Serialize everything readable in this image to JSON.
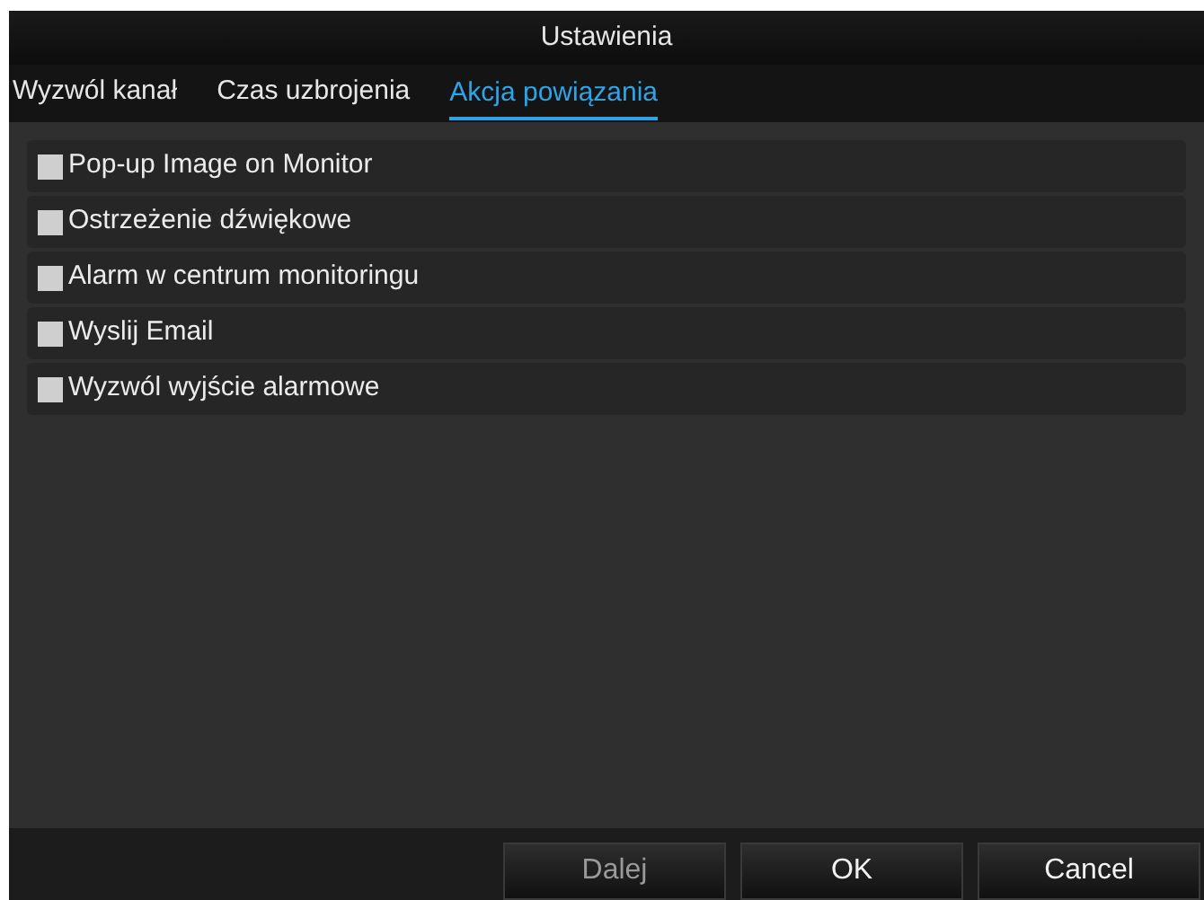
{
  "window": {
    "title": "Ustawienia"
  },
  "tabs": [
    {
      "label": "Wyzwól kanał",
      "selected": false
    },
    {
      "label": "Czas uzbrojenia",
      "selected": false
    },
    {
      "label": "Akcja powiązania",
      "selected": true
    }
  ],
  "options": [
    {
      "label": "Pop-up Image on Monitor",
      "checked": false
    },
    {
      "label": "Ostrzeżenie dźwiękowe",
      "checked": false
    },
    {
      "label": "Alarm w centrum monitoringu",
      "checked": false
    },
    {
      "label": "Wyslij Email",
      "checked": false
    },
    {
      "label": "Wyzwól wyjście alarmowe",
      "checked": false
    }
  ],
  "buttons": [
    {
      "label": "Dalej",
      "disabled": true
    },
    {
      "label": "OK",
      "disabled": false
    },
    {
      "label": "Cancel",
      "disabled": false
    }
  ]
}
